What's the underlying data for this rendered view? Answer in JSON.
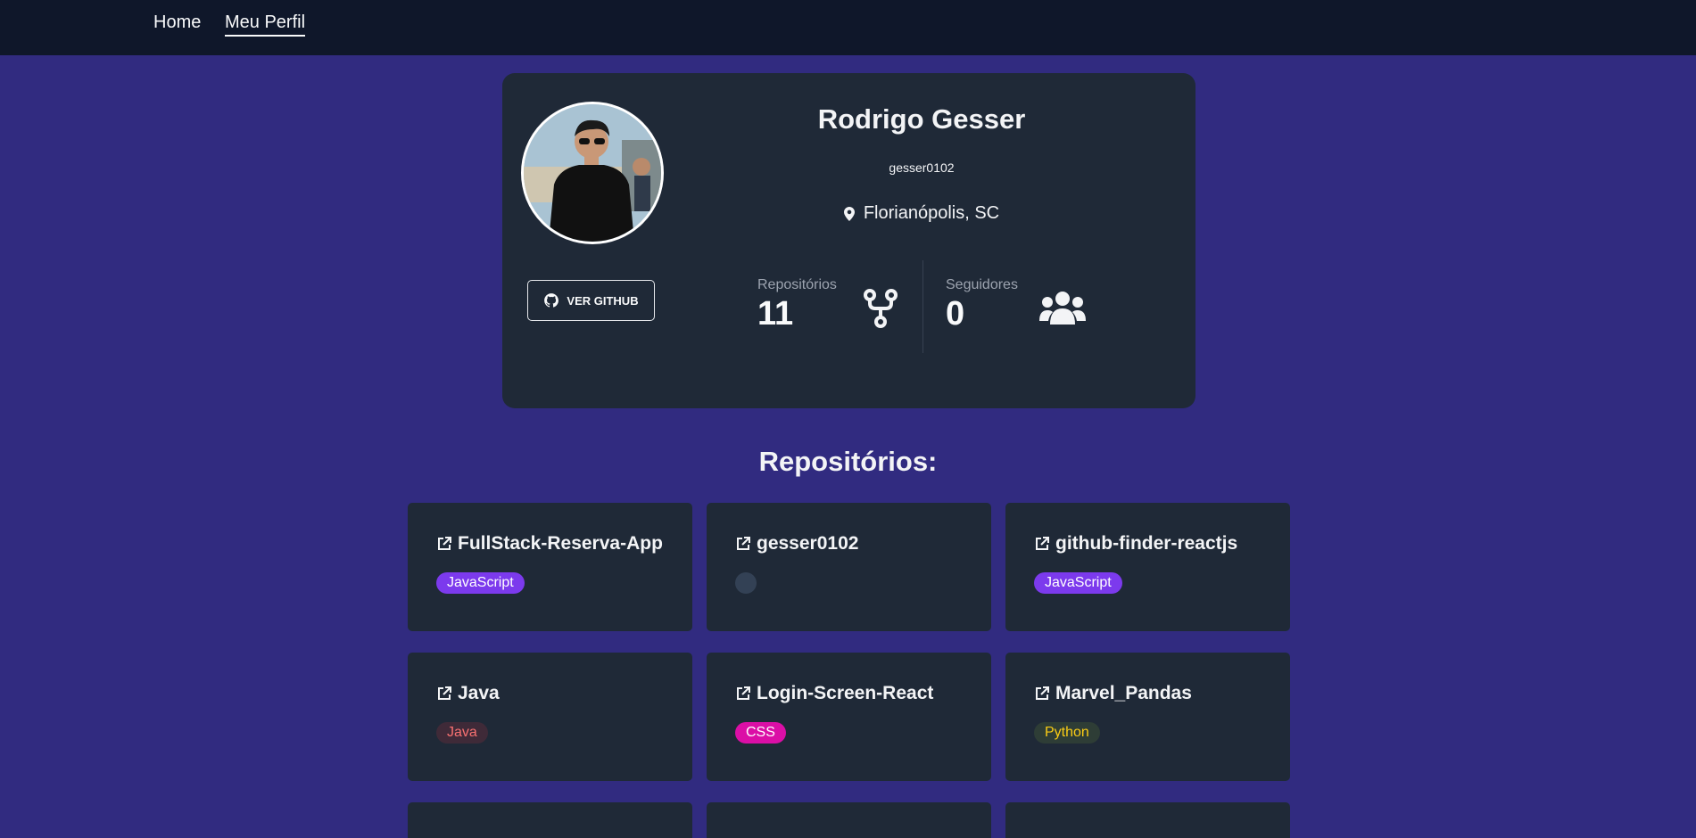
{
  "nav": {
    "home": "Home",
    "profile": "Meu Perfil"
  },
  "profile": {
    "name": "Rodrigo Gesser",
    "username": "gesser0102",
    "location": "Florianópolis, SC",
    "github_button": "VER GITHUB",
    "stats": {
      "repos_label": "Repositórios",
      "repos_value": "11",
      "followers_label": "Seguidores",
      "followers_value": "0"
    }
  },
  "repos_section": {
    "title": "Repositórios:",
    "items": [
      {
        "name": "FullStack-Reserva-App",
        "language": "JavaScript"
      },
      {
        "name": "gesser0102",
        "language": ""
      },
      {
        "name": "github-finder-reactjs",
        "language": "JavaScript"
      },
      {
        "name": "Java",
        "language": "Java"
      },
      {
        "name": "Login-Screen-React",
        "language": "CSS"
      },
      {
        "name": "Marvel_Pandas",
        "language": "Python"
      }
    ]
  },
  "colors": {
    "page_background": "#312b80",
    "navbar": "#0f172a",
    "card": "#1f2937",
    "javascript": "#7c3aed",
    "css": "#db0fa6"
  },
  "icons": [
    "github-icon",
    "map-pin-icon",
    "git-fork-icon",
    "users-icon",
    "external-link-icon"
  ]
}
